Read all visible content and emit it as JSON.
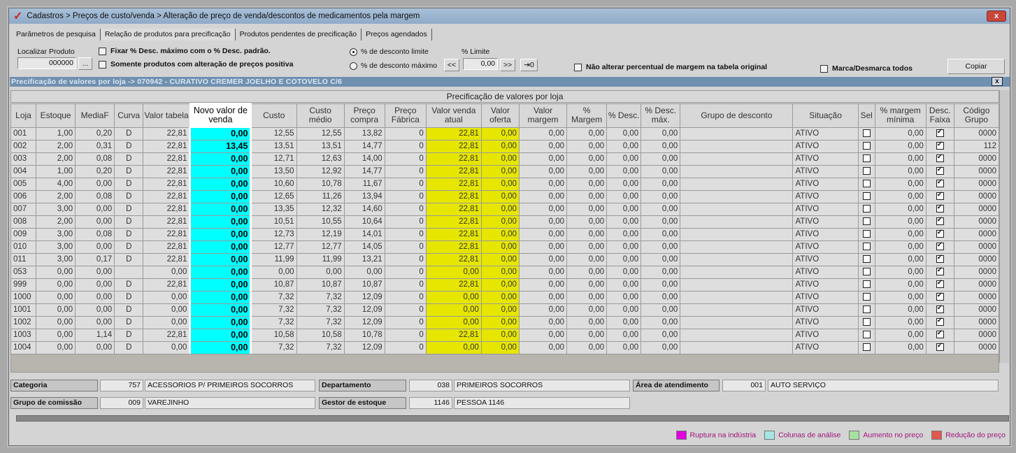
{
  "window": {
    "title": "Cadastros > Preços de custo/venda > Alteração de preço de venda/descontos de medicamentos pela margem",
    "close": "x"
  },
  "tabs": [
    {
      "label": "Parâmetros de pesquisa"
    },
    {
      "label": "Relação de produtos para precificação"
    },
    {
      "label": "Produtos pendentes de precificação"
    },
    {
      "label": "Preços agendados"
    }
  ],
  "toolbar": {
    "localizar_label": "Localizar Produto",
    "localizar_value": "000000",
    "browse": "...",
    "fixar_label": "Fixar % Desc. máximo com o % Desc. padrão.",
    "somente_label": "Somente produtos com alteração de preços positiva",
    "radio_limite": "% de desconto limite",
    "radio_maximo": "% de desconto máximo",
    "radio_selected": "limite",
    "limite_label": "% Limite",
    "limite_value": "0,00",
    "prev": "<<",
    "next": ">>",
    "apply": "⇥0",
    "nao_alterar_label": "Não alterar percentual de margem na tabela original",
    "marca_label": "Marca/Desmarca todos",
    "copiar": "Copiar"
  },
  "panel": {
    "title": "Precificação de valores por loja -> 070942 - CURATIVO CREMER JOELHO E COTOVELO C/6",
    "close": "x",
    "group_header": "Precificação de valores por loja"
  },
  "columns": [
    "Loja",
    "Estoque",
    "MediaF",
    "Curva",
    "Valor tabela",
    "Novo valor de venda",
    "Custo",
    "Custo médio",
    "Preço compra",
    "Preço Fábrica",
    "Valor venda atual",
    "Valor oferta",
    "Valor margem",
    "% Margem",
    "% Desc.",
    "% Desc. máx.",
    "Grupo de desconto",
    "Situação",
    "Sel",
    "% margem mínima",
    "Desc. Faixa",
    "Código Grupo"
  ],
  "rows": [
    [
      "001",
      "1,00",
      "0,20",
      "D",
      "22,81",
      "0,00",
      "12,55",
      "12,55",
      "13,82",
      "0",
      "22,81",
      "0,00",
      "0,00",
      "0,00",
      "0,00",
      "0,00",
      "",
      "ATIVO",
      false,
      "0,00",
      true,
      "0000"
    ],
    [
      "002",
      "2,00",
      "0,31",
      "D",
      "22,81",
      "13,45",
      "13,51",
      "13,51",
      "14,77",
      "0",
      "22,81",
      "0,00",
      "0,00",
      "0,00",
      "0,00",
      "0,00",
      "",
      "ATIVO",
      false,
      "0,00",
      true,
      "112"
    ],
    [
      "003",
      "2,00",
      "0,08",
      "D",
      "22,81",
      "0,00",
      "12,71",
      "12,63",
      "14,00",
      "0",
      "22,81",
      "0,00",
      "0,00",
      "0,00",
      "0,00",
      "0,00",
      "",
      "ATIVO",
      false,
      "0,00",
      true,
      "0000"
    ],
    [
      "004",
      "1,00",
      "0,20",
      "D",
      "22,81",
      "0,00",
      "13,50",
      "12,92",
      "14,77",
      "0",
      "22,81",
      "0,00",
      "0,00",
      "0,00",
      "0,00",
      "0,00",
      "",
      "ATIVO",
      false,
      "0,00",
      true,
      "0000"
    ],
    [
      "005",
      "4,00",
      "0,00",
      "D",
      "22,81",
      "0,00",
      "10,60",
      "10,78",
      "11,67",
      "0",
      "22,81",
      "0,00",
      "0,00",
      "0,00",
      "0,00",
      "0,00",
      "",
      "ATIVO",
      false,
      "0,00",
      true,
      "0000"
    ],
    [
      "006",
      "2,00",
      "0,08",
      "D",
      "22,81",
      "0,00",
      "12,65",
      "11,26",
      "13,94",
      "0",
      "22,81",
      "0,00",
      "0,00",
      "0,00",
      "0,00",
      "0,00",
      "",
      "ATIVO",
      false,
      "0,00",
      true,
      "0000"
    ],
    [
      "007",
      "3,00",
      "0,00",
      "D",
      "22,81",
      "0,00",
      "13,35",
      "12,32",
      "14,60",
      "0",
      "22,81",
      "0,00",
      "0,00",
      "0,00",
      "0,00",
      "0,00",
      "",
      "ATIVO",
      false,
      "0,00",
      true,
      "0000"
    ],
    [
      "008",
      "2,00",
      "0,00",
      "D",
      "22,81",
      "0,00",
      "10,51",
      "10,55",
      "10,64",
      "0",
      "22,81",
      "0,00",
      "0,00",
      "0,00",
      "0,00",
      "0,00",
      "",
      "ATIVO",
      false,
      "0,00",
      true,
      "0000"
    ],
    [
      "009",
      "3,00",
      "0,08",
      "D",
      "22,81",
      "0,00",
      "12,73",
      "12,19",
      "14,01",
      "0",
      "22,81",
      "0,00",
      "0,00",
      "0,00",
      "0,00",
      "0,00",
      "",
      "ATIVO",
      false,
      "0,00",
      true,
      "0000"
    ],
    [
      "010",
      "3,00",
      "0,00",
      "D",
      "22,81",
      "0,00",
      "12,77",
      "12,77",
      "14,05",
      "0",
      "22,81",
      "0,00",
      "0,00",
      "0,00",
      "0,00",
      "0,00",
      "",
      "ATIVO",
      false,
      "0,00",
      true,
      "0000"
    ],
    [
      "011",
      "3,00",
      "0,17",
      "D",
      "22,81",
      "0,00",
      "11,99",
      "11,99",
      "13,21",
      "0",
      "22,81",
      "0,00",
      "0,00",
      "0,00",
      "0,00",
      "0,00",
      "",
      "ATIVO",
      false,
      "0,00",
      true,
      "0000"
    ],
    [
      "053",
      "0,00",
      "0,00",
      "",
      "0,00",
      "0,00",
      "0,00",
      "0,00",
      "0,00",
      "0",
      "0,00",
      "0,00",
      "0,00",
      "0,00",
      "0,00",
      "0,00",
      "",
      "ATIVO",
      false,
      "0,00",
      true,
      "0000"
    ],
    [
      "999",
      "0,00",
      "0,00",
      "D",
      "22,81",
      "0,00",
      "10,87",
      "10,87",
      "10,87",
      "0",
      "22,81",
      "0,00",
      "0,00",
      "0,00",
      "0,00",
      "0,00",
      "",
      "ATIVO",
      false,
      "0,00",
      true,
      "0000"
    ],
    [
      "1000",
      "0,00",
      "0,00",
      "D",
      "0,00",
      "0,00",
      "7,32",
      "7,32",
      "12,09",
      "0",
      "0,00",
      "0,00",
      "0,00",
      "0,00",
      "0,00",
      "0,00",
      "",
      "ATIVO",
      false,
      "0,00",
      true,
      "0000"
    ],
    [
      "1001",
      "0,00",
      "0,00",
      "D",
      "0,00",
      "0,00",
      "7,32",
      "7,32",
      "12,09",
      "0",
      "0,00",
      "0,00",
      "0,00",
      "0,00",
      "0,00",
      "0,00",
      "",
      "ATIVO",
      false,
      "0,00",
      true,
      "0000"
    ],
    [
      "1002",
      "0,00",
      "0,00",
      "D",
      "0,00",
      "0,00",
      "7,32",
      "7,32",
      "12,09",
      "0",
      "0,00",
      "0,00",
      "0,00",
      "0,00",
      "0,00",
      "0,00",
      "",
      "ATIVO",
      false,
      "0,00",
      true,
      "0000"
    ],
    [
      "1003",
      "0,00",
      "1,14",
      "D",
      "22,81",
      "0,00",
      "10,58",
      "10,58",
      "10,78",
      "0",
      "22,81",
      "0,00",
      "0,00",
      "0,00",
      "0,00",
      "0,00",
      "",
      "ATIVO",
      false,
      "0,00",
      true,
      "0000"
    ],
    [
      "1004",
      "0,00",
      "0,00",
      "D",
      "0,00",
      "0,00",
      "7,32",
      "7,32",
      "12,09",
      "0",
      "0,00",
      "0,00",
      "0,00",
      "0,00",
      "0,00",
      "0,00",
      "",
      "ATIVO",
      false,
      "0,00",
      true,
      "0000"
    ]
  ],
  "info": {
    "categoria_label": "Categoria",
    "categoria_code": "757",
    "categoria_name": "ACESSORIOS P/ PRIMEIROS SOCORROS",
    "departamento_label": "Departamento",
    "departamento_code": "038",
    "departamento_name": "PRIMEIROS SOCORROS",
    "area_label": "Área de atendimento",
    "area_code": "001",
    "area_name": "AUTO SERVIÇO",
    "grupo_label": "Grupo de comissão",
    "grupo_code": "009",
    "grupo_name": "VAREJINHO",
    "gestor_label": "Gestor de estoque",
    "gestor_code": "1146",
    "gestor_name": "PESSOA 1146"
  },
  "legend": [
    {
      "label": "Ruptura na indústria",
      "color": "#e000e0"
    },
    {
      "label": "Colunas de análise",
      "color": "#a8e4e4"
    },
    {
      "label": "Aumento no preço",
      "color": "#a8e0a0"
    },
    {
      "label": "Redução do preço",
      "color": "#e05a50"
    }
  ]
}
